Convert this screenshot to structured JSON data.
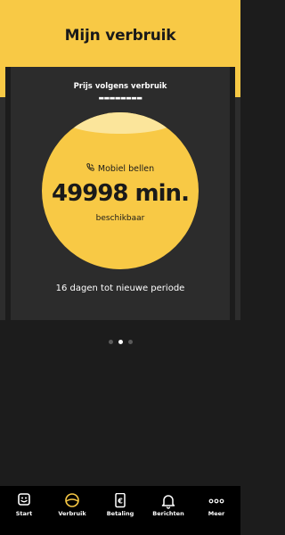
{
  "header": {
    "title": "Mijn verbruik"
  },
  "card": {
    "title": "Prijs volgens verbruik",
    "subtitle": "▬▬▬▬▬▬▬▬",
    "service_label": "Mobiel bellen",
    "value": "49998 min.",
    "caption": "beschikbaar",
    "footer": "16 dagen tot nieuwe periode"
  },
  "pager": {
    "count": 3,
    "active_index": 1
  },
  "colors": {
    "accent": "#f8c945",
    "background": "#1c1c1c",
    "card": "#2c2c2c",
    "tabbar": "#000000"
  },
  "tabs": [
    {
      "label": "Start",
      "icon": "smiley-box-icon"
    },
    {
      "label": "Verbruik",
      "icon": "gauge-circle-icon",
      "active": true
    },
    {
      "label": "Betaling",
      "icon": "euro-card-icon"
    },
    {
      "label": "Berichten",
      "icon": "bell-icon"
    },
    {
      "label": "Meer",
      "icon": "more-dots-icon"
    }
  ]
}
